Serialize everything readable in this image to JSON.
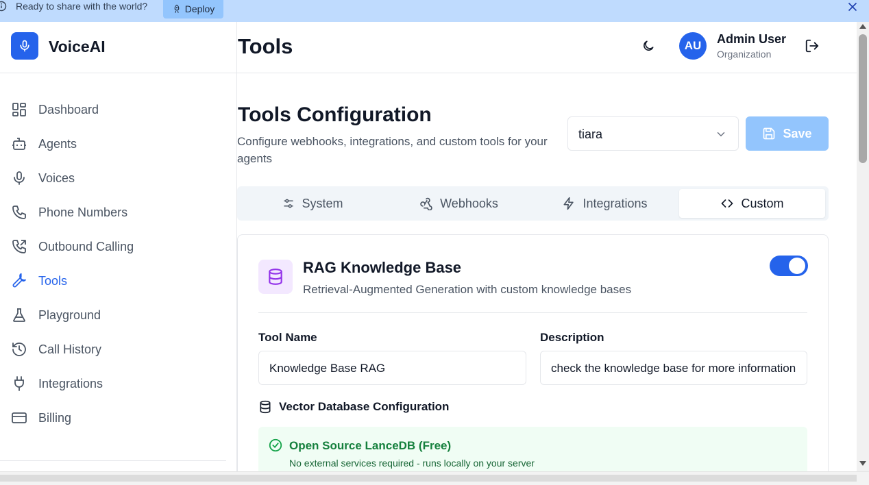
{
  "banner": {
    "message": "Ready to share with the world?",
    "deploy_label": "Deploy"
  },
  "brand": {
    "name": "VoiceAI"
  },
  "sidebar": {
    "items": [
      {
        "label": "Dashboard",
        "icon": "dashboard-icon"
      },
      {
        "label": "Agents",
        "icon": "bot-icon"
      },
      {
        "label": "Voices",
        "icon": "microphone-icon"
      },
      {
        "label": "Phone Numbers",
        "icon": "phone-icon"
      },
      {
        "label": "Outbound Calling",
        "icon": "phone-outgoing-icon"
      },
      {
        "label": "Tools",
        "icon": "wrench-icon",
        "active": true
      },
      {
        "label": "Playground",
        "icon": "flask-icon"
      },
      {
        "label": "Call History",
        "icon": "history-icon"
      },
      {
        "label": "Integrations",
        "icon": "plug-icon"
      },
      {
        "label": "Billing",
        "icon": "credit-card-icon"
      }
    ]
  },
  "header": {
    "title": "Tools",
    "user": {
      "initials": "AU",
      "name": "Admin User",
      "org": "Organization"
    }
  },
  "config": {
    "title": "Tools Configuration",
    "subtitle": "Configure webhooks, integrations, and custom tools for your agents",
    "agent_select": "tiara",
    "save_label": "Save"
  },
  "tabs": [
    {
      "label": "System",
      "icon": "sliders-icon"
    },
    {
      "label": "Webhooks",
      "icon": "webhook-icon"
    },
    {
      "label": "Integrations",
      "icon": "zap-icon"
    },
    {
      "label": "Custom",
      "icon": "code-icon",
      "active": true
    }
  ],
  "rag": {
    "title": "RAG Knowledge Base",
    "subtitle": "Retrieval-Augmented Generation with custom knowledge bases",
    "enabled": true,
    "tool_name_label": "Tool Name",
    "tool_name_value": "Knowledge Base RAG",
    "description_label": "Description",
    "description_value": "check the knowledge base for more information",
    "vector_db_label": "Vector Database Configuration",
    "lancedb_title": "Open Source LanceDB (Free)",
    "lancedb_desc": "No external services required - runs locally on your server"
  },
  "colors": {
    "accent": "#2563eb",
    "banner": "#bfdbfe",
    "success": "#15803d"
  }
}
